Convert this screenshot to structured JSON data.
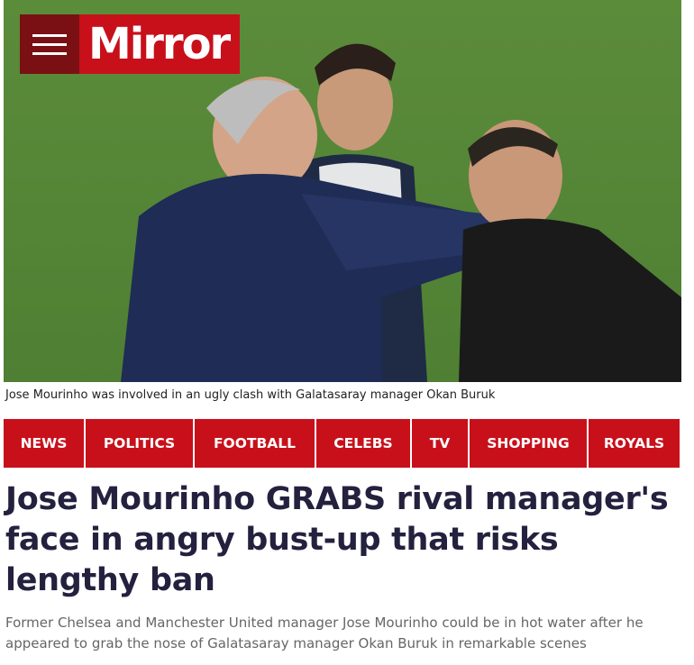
{
  "header": {
    "brand": "Mirror",
    "menu_icon": "hamburger-menu-icon",
    "colors": {
      "brand_red": "#c8101a",
      "menu_dark": "#7a1014"
    }
  },
  "hero": {
    "caption": "Jose Mourinho was involved in an ugly clash with Galatasaray manager Okan Buruk"
  },
  "nav": {
    "items": [
      {
        "label": "NEWS"
      },
      {
        "label": "POLITICS"
      },
      {
        "label": "FOOTBALL"
      },
      {
        "label": "CELEBS"
      },
      {
        "label": "TV"
      },
      {
        "label": "SHOPPING"
      },
      {
        "label": "ROYALS"
      }
    ]
  },
  "article": {
    "headline": "Jose Mourinho GRABS rival manager's face in angry bust-up that risks lengthy ban",
    "standfirst": "Former Chelsea and Manchester United manager Jose Mourinho could be in hot water after he appeared to grab the nose of Galatasaray manager Okan Buruk in remarkable scenes"
  }
}
